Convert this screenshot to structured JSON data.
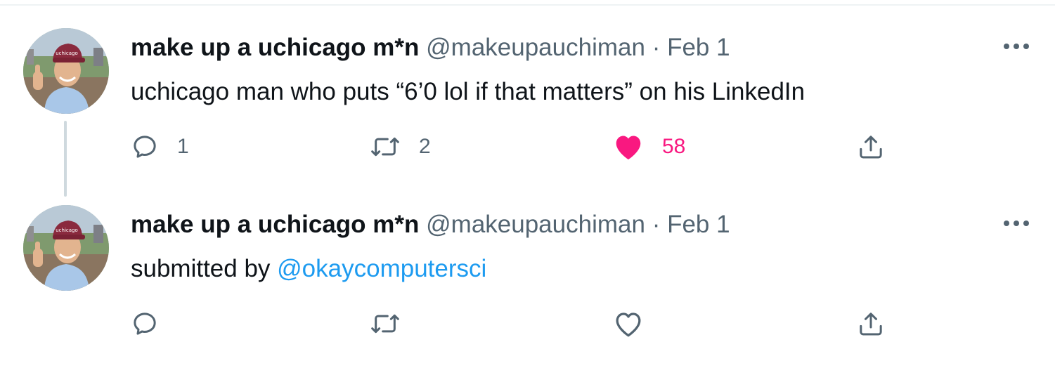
{
  "thread": {
    "tweets": [
      {
        "author_name": "make up a uchicago m*n",
        "handle": "@makeupauchiman",
        "separator": "·",
        "date": "Feb 1",
        "text": "uchicago man who puts “6’0 lol if that matters” on his LinkedIn",
        "reply_count": "1",
        "retweet_count": "2",
        "like_count": "58",
        "liked": true,
        "avatar_cap_text": "uchicago"
      },
      {
        "author_name": "make up a uchicago m*n",
        "handle": "@makeupauchiman",
        "separator": "·",
        "date": "Feb 1",
        "text_prefix": "submitted by ",
        "mention": "@okaycomputersci",
        "liked": false,
        "avatar_cap_text": "uchicago"
      }
    ]
  },
  "colors": {
    "like_active": "#f91880",
    "mention": "#1d9bf0",
    "secondary_text": "#536471",
    "icon": "#536471",
    "thread_line": "#cfd9de"
  },
  "icons": {
    "reply": "reply-icon",
    "retweet": "retweet-icon",
    "like_filled": "heart-filled-icon",
    "like_outline": "heart-outline-icon",
    "share": "share-icon",
    "more": "more-icon"
  }
}
